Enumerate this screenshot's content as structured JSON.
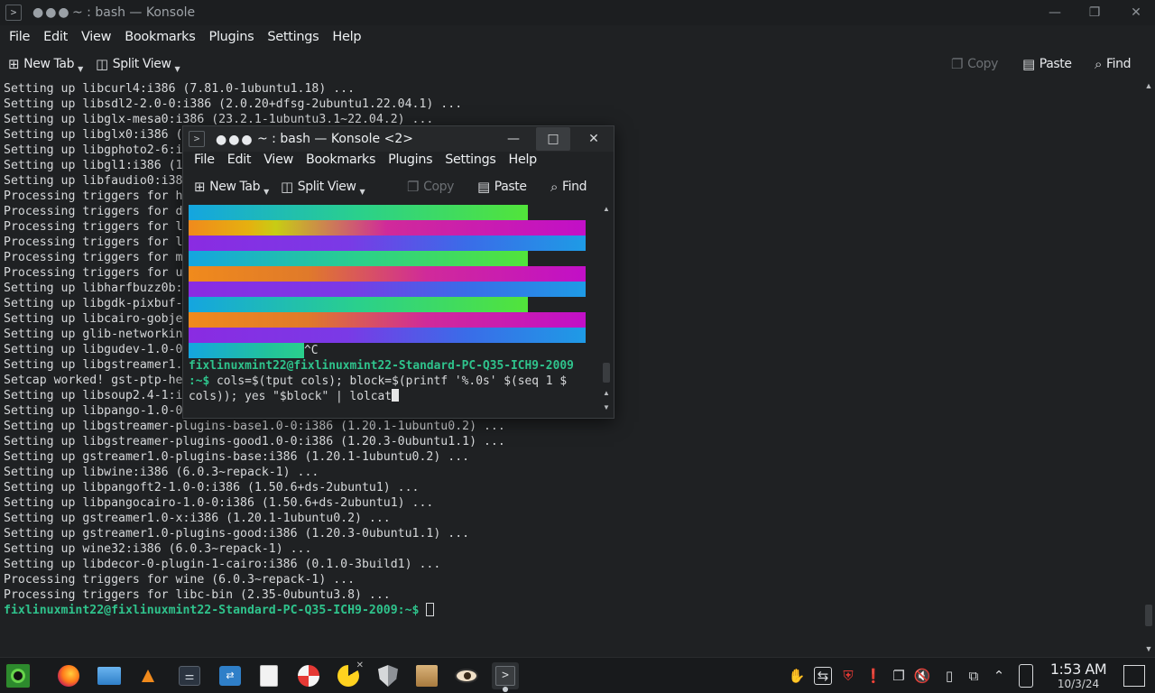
{
  "main_window": {
    "title": "~ : bash — Konsole",
    "menu": [
      "File",
      "Edit",
      "View",
      "Bookmarks",
      "Plugins",
      "Settings",
      "Help"
    ],
    "toolbar": {
      "new_tab": "New Tab",
      "split_view": "Split View",
      "copy": "Copy",
      "paste": "Paste",
      "find": "Find"
    },
    "terminal_lines": [
      "Setting up libcurl4:i386 (7.81.0-1ubuntu1.18) ...",
      "Setting up libsdl2-2.0-0:i386 (2.0.20+dfsg-2ubuntu1.22.04.1) ...",
      "Setting up libglx-mesa0:i386 (23.2.1-1ubuntu3.1~22.04.2) ...",
      "Setting up libglx0:i386 (",
      "Setting up libgphoto2-6:i",
      "Setting up libgl1:i386 (1",
      "Setting up libfaudio0:i38",
      "Processing triggers for h",
      "Processing triggers for d",
      "Processing triggers for l",
      "Processing triggers for l",
      "Processing triggers for m",
      "Processing triggers for u",
      "Setting up libharfbuzz0b:",
      "Setting up libgdk-pixbuf-",
      "Setting up libcairo-gobje",
      "Setting up glib-networkin",
      "Setting up libgudev-1.0-0",
      "Setting up libgstreamer1.",
      "Setcap worked! gst-ptp-he",
      "Setting up libsoup2.4-1:i",
      "Setting up libpango-1.0-0",
      "Setting up libgstreamer-plugins-base1.0-0:i386 (1.20.1-1ubuntu0.2) ...",
      "Setting up libgstreamer-plugins-good1.0-0:i386 (1.20.3-0ubuntu1.1) ...",
      "Setting up gstreamer1.0-plugins-base:i386 (1.20.1-1ubuntu0.2) ...",
      "Setting up libwine:i386 (6.0.3~repack-1) ...",
      "Setting up libpangoft2-1.0-0:i386 (1.50.6+ds-2ubuntu1) ...",
      "Setting up libpangocairo-1.0-0:i386 (1.50.6+ds-2ubuntu1) ...",
      "Setting up gstreamer1.0-x:i386 (1.20.1-1ubuntu0.2) ...",
      "Setting up gstreamer1.0-plugins-good:i386 (1.20.3-0ubuntu1.1) ...",
      "Setting up wine32:i386 (6.0.3~repack-1) ...",
      "Setting up libdecor-0-plugin-1-cairo:i386 (0.1.0-3build1) ...",
      "Processing triggers for wine (6.0.3~repack-1) ...",
      "Processing triggers for libc-bin (2.35-0ubuntu3.8) ..."
    ],
    "prompt": "fixlinuxmint22@fixlinuxmint22-Standard-PC-Q35-ICH9-2009:~$ "
  },
  "second_window": {
    "title": "~ : bash — Konsole <2>",
    "menu": [
      "File",
      "Edit",
      "View",
      "Bookmarks",
      "Plugins",
      "Settings",
      "Help"
    ],
    "toolbar": {
      "new_tab": "New Tab",
      "split_view": "Split View",
      "copy": "Copy",
      "paste": "Paste",
      "find": "Find"
    },
    "interrupt": "^C",
    "prompt_host": "fixlinuxmint22@fixlinuxmint22-Standard-PC-Q35-ICH9-2009",
    "prompt_tail": ":~$ ",
    "command_line1": "cols=$(tput cols); block=$(printf '%.0s' $(seq 1 $",
    "command_line2": "cols)); yes \"$block\" | lolcat"
  },
  "taskbar": {
    "clock_time": "1:53 AM",
    "clock_date": "10/3/24",
    "apps": [
      "menu-icon",
      "firefox-icon",
      "files-icon",
      "vlc-icon",
      "settings-icon",
      "software-icon",
      "text-editor-icon",
      "help-icon",
      "pacman-icon",
      "shield-icon",
      "archive-icon",
      "eye-icon",
      "konsole-icon"
    ]
  },
  "colors": {
    "prompt_green": "#2fc38c",
    "bar_green": "#52e43a",
    "bar_magenta": "#c20fc7",
    "bar_purple": "#8a2be2",
    "bar_blue": "#1e9be6",
    "bar_orange": "#f08a1c"
  }
}
